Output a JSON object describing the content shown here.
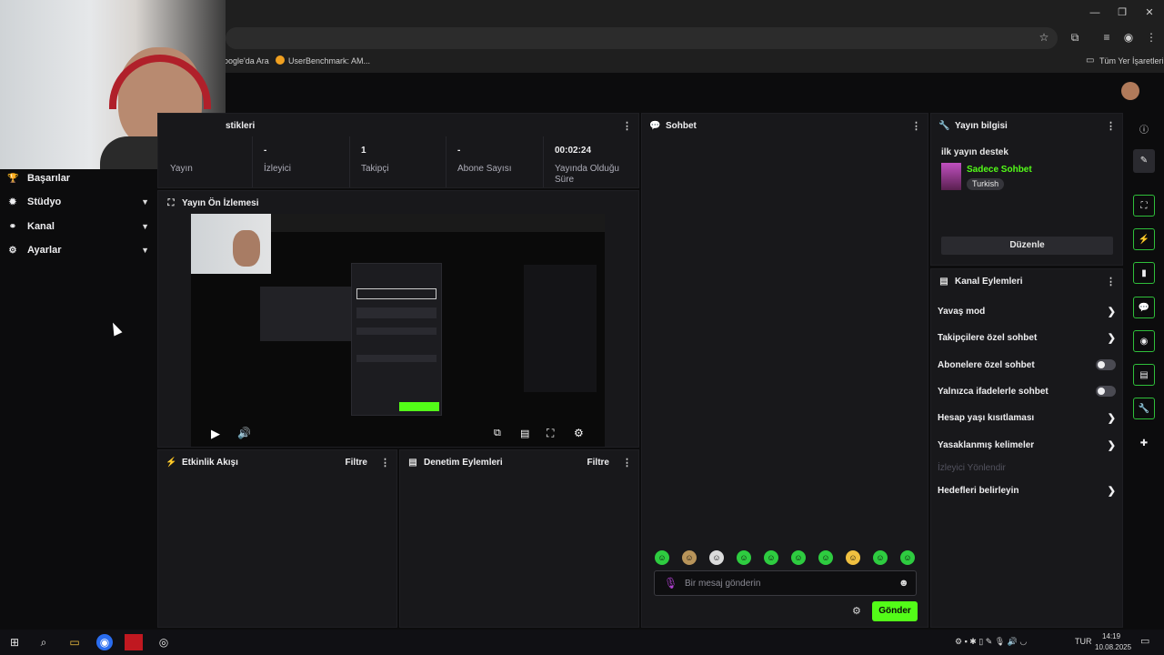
{
  "browser": {
    "bookmarks": [
      "oogle'da Ara",
      "UserBenchmark: AM..."
    ],
    "bookmarks_right": "Tüm Yer İşaretleri",
    "window_controls": [
      "minimize-icon",
      "restore-icon",
      "close-icon"
    ]
  },
  "sidebar": {
    "items": [
      {
        "label": "Başarılar",
        "icon": "trophy-icon",
        "chevron": false
      },
      {
        "label": "Stüdyo",
        "icon": "studio-icon",
        "chevron": true
      },
      {
        "label": "Kanal",
        "icon": "channel-icon",
        "chevron": true
      },
      {
        "label": "Ayarlar",
        "icon": "gear-icon",
        "chevron": true
      }
    ]
  },
  "stats_panel": {
    "title": "stikleri",
    "stats": [
      {
        "value": "",
        "label": "Yayın"
      },
      {
        "value": "-",
        "label": "İzleyici"
      },
      {
        "value": "1",
        "label": "Takipçi"
      },
      {
        "value": "-",
        "label": "Abone Sayısı"
      },
      {
        "value": "00:02:24",
        "label": "Yayında Olduğu Süre"
      }
    ]
  },
  "preview_panel": {
    "title": "Yayın Ön İzlemesi"
  },
  "activity_panel": {
    "title": "Etkinlik Akışı",
    "filter": "Filtre"
  },
  "moderation_panel": {
    "title": "Denetim Eylemleri",
    "filter": "Filtre"
  },
  "chat_panel": {
    "title": "Sohbet",
    "input_placeholder": "Bir mesaj gönderin",
    "send_label": "Gönder"
  },
  "stream_info": {
    "title": "Yayın bilgisi",
    "stream_title": "ilk yayın destek",
    "category": "Sadece Sohbet",
    "language_tag": "Turkish",
    "edit_label": "Düzenle"
  },
  "channel_actions": {
    "title": "Kanal Eylemleri",
    "items": [
      {
        "label": "Yavaş mod",
        "control": "arrow"
      },
      {
        "label": "Takipçilere özel sohbet",
        "control": "arrow"
      },
      {
        "label": "Abonelere özel sohbet",
        "control": "toggle"
      },
      {
        "label": "Yalnızca ifadelerle sohbet",
        "control": "toggle"
      },
      {
        "label": "Hesap yaşı kısıtlaması",
        "control": "arrow"
      },
      {
        "label": "Yasaklanmış kelimeler",
        "control": "arrow"
      },
      {
        "label": "İzleyici Yönlendir",
        "control": "none"
      },
      {
        "label": "Hedefleri belirleyin",
        "control": "arrow"
      }
    ]
  },
  "taskbar": {
    "language": "TUR",
    "time": "14:19",
    "date": "10.08.2025"
  },
  "colors": {
    "accent": "#53fc18",
    "panel": "#18181b",
    "background": "#0c0c0d"
  }
}
